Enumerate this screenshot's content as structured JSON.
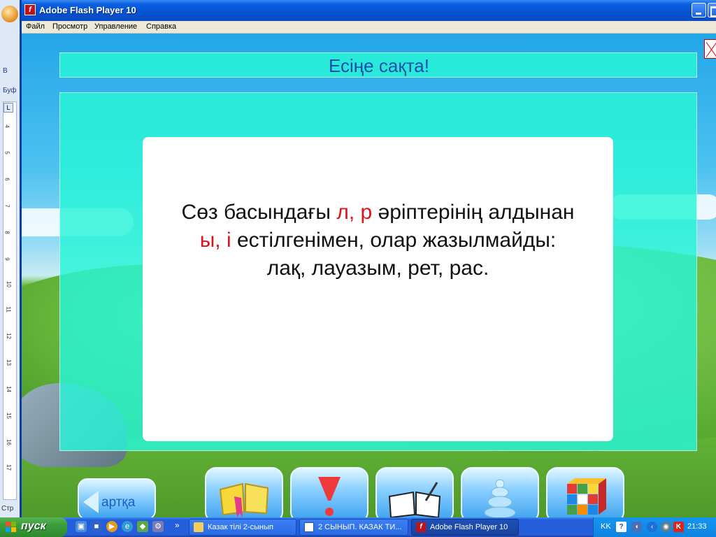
{
  "background_window": {
    "labels": [
      "В",
      "Буф"
    ],
    "status_label": "Стр",
    "ruler_numbers": [
      "4",
      "5",
      "6",
      "7",
      "8",
      "9",
      "10",
      "11",
      "12",
      "13",
      "14",
      "15",
      "16",
      "17"
    ]
  },
  "window": {
    "title": "Adobe Flash Player 10",
    "icon": "flash-icon",
    "menu": [
      "Файл",
      "Просмотр",
      "Управление",
      "Справка"
    ]
  },
  "lesson": {
    "heading": "Есіңе сақта!",
    "rule_line1_a": "Сөз басындағы ",
    "rule_line1_red": "л, р",
    "rule_line1_b": " әріптерінің алдынан",
    "rule_line2_red": "ы, і",
    "rule_line2_b": " естілгенімен, олар жазылмайды:",
    "rule_line3": "лақ, лауазым, рет, рас.",
    "back_label": "артқа",
    "nav_icons": [
      "book-icon",
      "exclamation-icon",
      "open-book-pen-icon",
      "pyramid-stack-icon",
      "rubik-cube-icon"
    ]
  },
  "taskbar": {
    "start_label": "пуск",
    "quick_launch_more": "»",
    "tasks": [
      {
        "label": "Казак тілі 2-сынып",
        "icon": "folder-icon",
        "active": false
      },
      {
        "label": "2 СЫНЫП. КАЗАК ТИ...",
        "icon": "word-doc-icon",
        "active": false
      },
      {
        "label": "Adobe Flash Player 10",
        "icon": "flash-icon",
        "active": true
      }
    ],
    "language": "KK",
    "clock": "21:33"
  },
  "colors": {
    "accent_red": "#e0131a",
    "heading_blue": "#1a4ea8",
    "panel_teal": "#28f5d7"
  }
}
